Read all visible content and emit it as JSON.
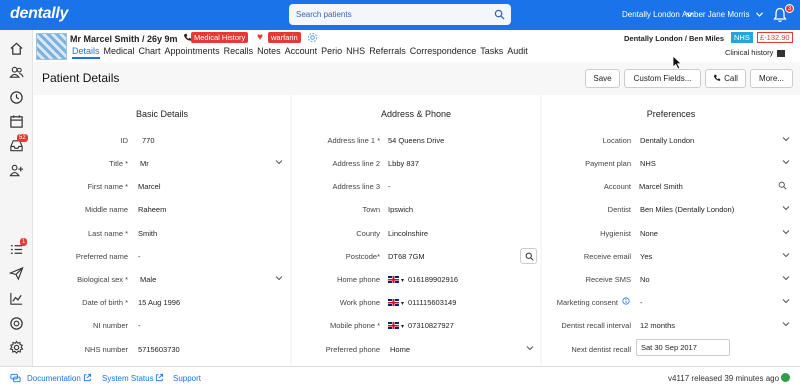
{
  "app": {
    "logo": "dentally"
  },
  "topbar": {
    "search_placeholder": "Search patients",
    "practice": "Dentally London",
    "user": "Amber Jane Morris",
    "notifications_count": "3"
  },
  "sidebar": {
    "badges": {
      "inbox": "52",
      "tasks": "1"
    }
  },
  "patient": {
    "name": "Mr Marcel Smith / 26y 9m",
    "medical_history": "Medical History",
    "alert": "warfarin",
    "practice_dentist": "Dentally London / Ben Miles",
    "nhs": "NHS",
    "balance": "£-132.90",
    "clinical_history": "Clinical history"
  },
  "tabs": [
    "Details",
    "Medical",
    "Chart",
    "Appointments",
    "Recalls",
    "Notes",
    "Account",
    "Perio",
    "NHS",
    "Referrals",
    "Correspondence",
    "Tasks",
    "Audit"
  ],
  "page": {
    "title": "Patient Details",
    "buttons": {
      "save": "Save",
      "custom_fields": "Custom Fields...",
      "call": "Call",
      "more": "More..."
    }
  },
  "basic": {
    "title": "Basic Details",
    "rows": [
      {
        "label": "ID",
        "value": "770"
      },
      {
        "label": "Title *",
        "value": "Mr"
      },
      {
        "label": "First name *",
        "value": "Marcel"
      },
      {
        "label": "Middle name",
        "value": "Raheem"
      },
      {
        "label": "Last name *",
        "value": "Smith"
      },
      {
        "label": "Preferred name",
        "value": "-"
      },
      {
        "label": "Biological sex *",
        "value": "Male"
      },
      {
        "label": "Date of birth *",
        "value": "15 Aug 1996"
      },
      {
        "label": "NI number",
        "value": "-"
      },
      {
        "label": "NHS number",
        "value": "5715603730"
      }
    ]
  },
  "address": {
    "title": "Address & Phone",
    "rows": [
      {
        "label": "Address line 1 *",
        "value": "54 Queens Drive"
      },
      {
        "label": "Address line 2",
        "value": "Lbby 837"
      },
      {
        "label": "Address line 3",
        "value": "-"
      },
      {
        "label": "Town",
        "value": "Ipswich"
      },
      {
        "label": "County",
        "value": "Lincolnshire"
      },
      {
        "label": "Postcode*",
        "value": "DT68 7GM"
      },
      {
        "label": "Home phone",
        "value": "016189902916"
      },
      {
        "label": "Work phone",
        "value": "011115603149"
      },
      {
        "label": "Mobile phone *",
        "value": "07310827927"
      },
      {
        "label": "Preferred phone",
        "value": "Home"
      }
    ]
  },
  "prefs": {
    "title": "Preferences",
    "rows": [
      {
        "label": "Location",
        "value": "Dentally London"
      },
      {
        "label": "Payment plan",
        "value": "NHS"
      },
      {
        "label": "Account",
        "value": "Marcel Smith"
      },
      {
        "label": "Dentist",
        "value": "Ben Miles (Dentally London)"
      },
      {
        "label": "Hygienist",
        "value": "None"
      },
      {
        "label": "Receive email",
        "value": "Yes"
      },
      {
        "label": "Receive SMS",
        "value": "No"
      },
      {
        "label": "Marketing consent",
        "value": "-"
      },
      {
        "label": "Dentist recall interval",
        "value": "12 months"
      },
      {
        "label": "Next dentist recall",
        "value": "Sat 30 Sep 2017"
      }
    ]
  },
  "footer": {
    "documentation": "Documentation",
    "system_status": "System Status",
    "support": "Support",
    "version": "v4117 released 39 minutes ago"
  }
}
